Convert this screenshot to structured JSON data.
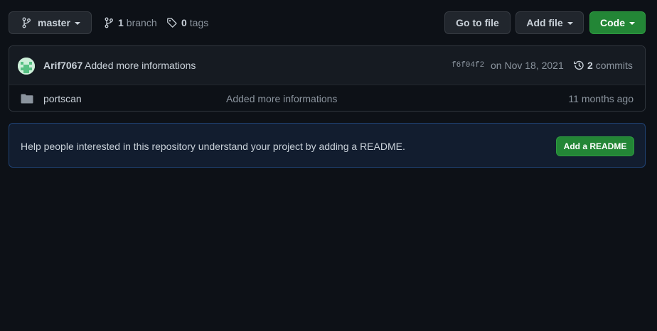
{
  "toolbar": {
    "branch_button_label": "master",
    "branches_count": "1",
    "branches_label": "branch",
    "tags_count": "0",
    "tags_label": "tags",
    "go_to_file_label": "Go to file",
    "add_file_label": "Add file",
    "code_label": "Code"
  },
  "latest_commit": {
    "author": "Arif7067",
    "message": "Added more informations",
    "sha": "f6f04f2",
    "date": "on Nov 18, 2021",
    "commits_count": "2",
    "commits_label": "commits"
  },
  "files": [
    {
      "icon": "folder-icon",
      "name": "portscan",
      "commit_message": "Added more informations",
      "age": "11 months ago"
    }
  ],
  "readme_prompt": {
    "text": "Help people interested in this repository understand your project by adding a README.",
    "button_label": "Add a README"
  },
  "colors": {
    "background": "#0d1117",
    "primary_button": "#238636",
    "readme_banner": "#121d2f"
  }
}
